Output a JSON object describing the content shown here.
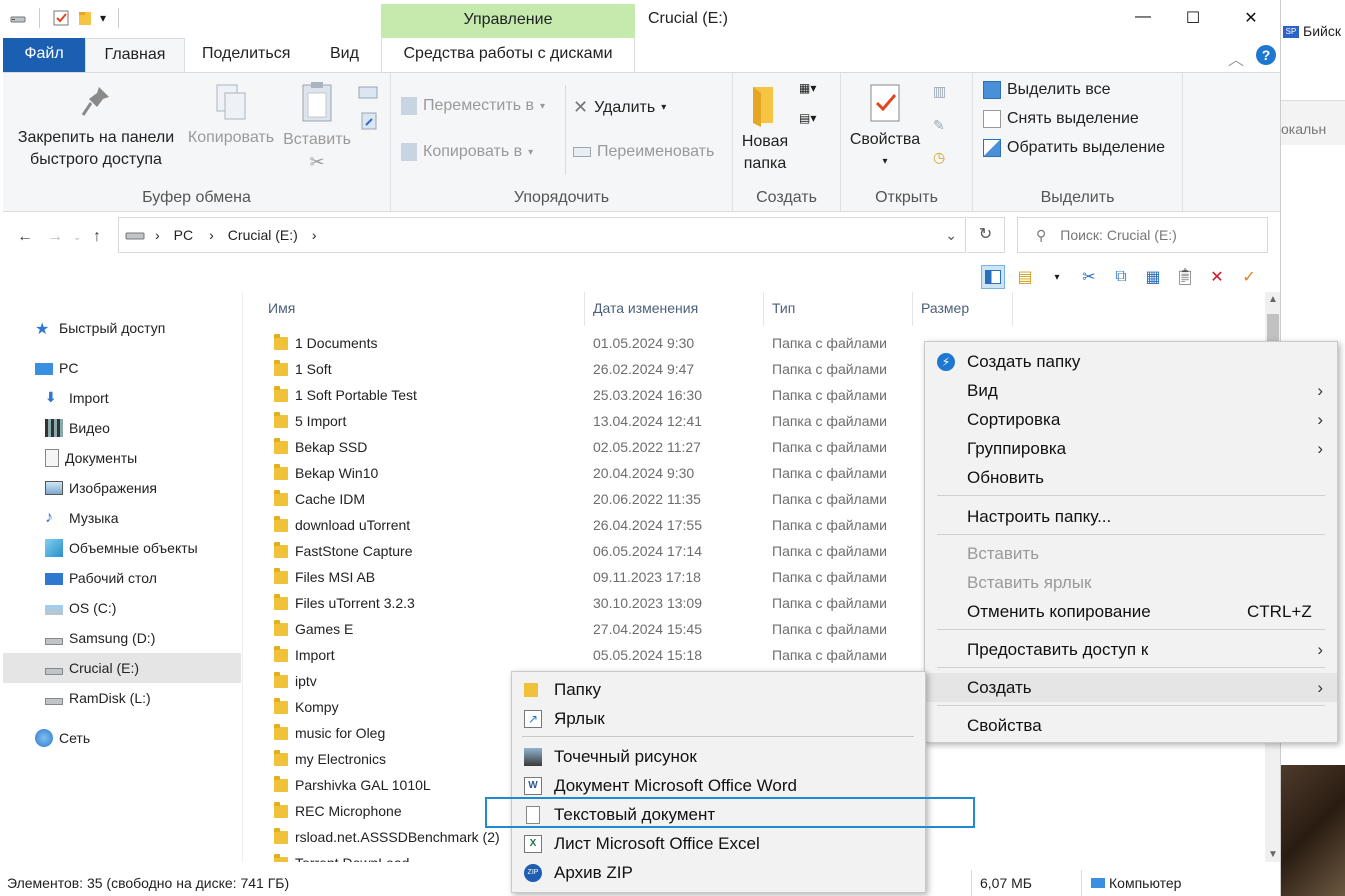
{
  "window": {
    "title": "Crucial (E:)",
    "manage_label": "Управление",
    "controls": {
      "minimize": "—",
      "maximize": "☐",
      "close": "✕"
    }
  },
  "desktop": {
    "top_text": "Бийск",
    "mid_text": "окальн",
    "badge": "SP"
  },
  "tabs": {
    "file": "Файл",
    "home": "Главная",
    "share": "Поделиться",
    "view": "Вид",
    "disk_tools": "Средства работы с дисками"
  },
  "ribbon": {
    "clipboard": {
      "label": "Буфер обмена",
      "pin": "Закрепить на панели быстрого доступа",
      "pin_line1": "Закрепить на панели",
      "pin_line2": "быстрого доступа",
      "copy": "Копировать",
      "paste": "Вставить"
    },
    "organize": {
      "label": "Упорядочить",
      "move_to": "Переместить в",
      "copy_to": "Копировать в",
      "delete": "Удалить",
      "rename": "Переименовать"
    },
    "new": {
      "label": "Создать",
      "new_folder_line1": "Новая",
      "new_folder_line2": "папка"
    },
    "open": {
      "label": "Открыть",
      "properties": "Свойства"
    },
    "select": {
      "label": "Выделить",
      "select_all": "Выделить все",
      "select_none": "Снять выделение",
      "invert": "Обратить выделение"
    }
  },
  "address": {
    "path": [
      "PC",
      "Crucial (E:)"
    ],
    "search_placeholder": "Поиск: Crucial (E:)"
  },
  "nav": {
    "quick_access": "Быстрый доступ",
    "pc": "PC",
    "items": [
      "Import",
      "Видео",
      "Документы",
      "Изображения",
      "Музыка",
      "Объемные объекты",
      "Рабочий стол",
      "OS (C:)",
      "Samsung (D:)",
      "Crucial (E:)",
      "RamDisk (L:)"
    ],
    "network": "Сеть",
    "selected": "Crucial (E:)"
  },
  "columns": {
    "name": "Имя",
    "date": "Дата изменения",
    "type": "Тип",
    "size": "Размер"
  },
  "files": [
    {
      "name": "1 Documents",
      "date": "01.05.2024 9:30",
      "type": "Папка с файлами"
    },
    {
      "name": "1 Soft",
      "date": "26.02.2024 9:47",
      "type": "Папка с файлами"
    },
    {
      "name": "1 Soft Portable Test",
      "date": "25.03.2024 16:30",
      "type": "Папка с файлами"
    },
    {
      "name": "5 Import",
      "date": "13.04.2024 12:41",
      "type": "Папка с файлами"
    },
    {
      "name": "Bekap SSD",
      "date": "02.05.2022 11:27",
      "type": "Папка с файлами"
    },
    {
      "name": "Bekap Win10",
      "date": "20.04.2024 9:30",
      "type": "Папка с файлами"
    },
    {
      "name": "Cache IDM",
      "date": "20.06.2022 11:35",
      "type": "Папка с файлами"
    },
    {
      "name": "download uTorrent",
      "date": "26.04.2024 17:55",
      "type": "Папка с файлами"
    },
    {
      "name": "FastStone Capture",
      "date": "06.05.2024 17:14",
      "type": "Папка с файлами"
    },
    {
      "name": "Files MSI AB",
      "date": "09.11.2023 17:18",
      "type": "Папка с файлами"
    },
    {
      "name": "Files uTorrent 3.2.3",
      "date": "30.10.2023 13:09",
      "type": "Папка с файлами"
    },
    {
      "name": "Games E",
      "date": "27.04.2024 15:45",
      "type": "Папка с файлами"
    },
    {
      "name": "Import",
      "date": "05.05.2024 15:18",
      "type": "Папка с файлами"
    },
    {
      "name": "iptv",
      "date": "",
      "type": ""
    },
    {
      "name": "Kompy",
      "date": "",
      "type": ""
    },
    {
      "name": "music for Oleg",
      "date": "",
      "type": ""
    },
    {
      "name": "my Electronics",
      "date": "",
      "type": ""
    },
    {
      "name": "Parshivka GAL 1010L",
      "date": "",
      "type": ""
    },
    {
      "name": "REC Microphone",
      "date": "",
      "type": ""
    },
    {
      "name": "rsload.net.ASSSDBenchmark (2)",
      "date": "",
      "type": ""
    },
    {
      "name": "Torrent DownLoad",
      "date": "",
      "type": ""
    }
  ],
  "status": {
    "items": "Элементов: 35 (свободно на диске: 741 ГБ)",
    "size": "6,07 МБ",
    "computer": "Компьютер"
  },
  "context_menu": {
    "create_folder": "Создать папку",
    "view": "Вид",
    "sort": "Сортировка",
    "group": "Группировка",
    "refresh": "Обновить",
    "customize": "Настроить папку...",
    "paste": "Вставить",
    "paste_shortcut": "Вставить ярлык",
    "undo_copy": "Отменить копирование",
    "undo_shortcut": "CTRL+Z",
    "share": "Предоставить доступ к",
    "new": "Создать",
    "properties": "Свойства"
  },
  "submenu": {
    "folder": "Папку",
    "shortcut": "Ярлык",
    "bitmap": "Точечный рисунок",
    "word": "Документ Microsoft Office Word",
    "text": "Текстовый документ",
    "excel": "Лист Microsoft Office Excel",
    "zip": "Архив ZIP"
  },
  "colors": {
    "accent": "#1b5fb3",
    "manage_tab": "#c4ebad",
    "highlight_box": "#1f8ad2",
    "folder": "#f0c23a"
  }
}
